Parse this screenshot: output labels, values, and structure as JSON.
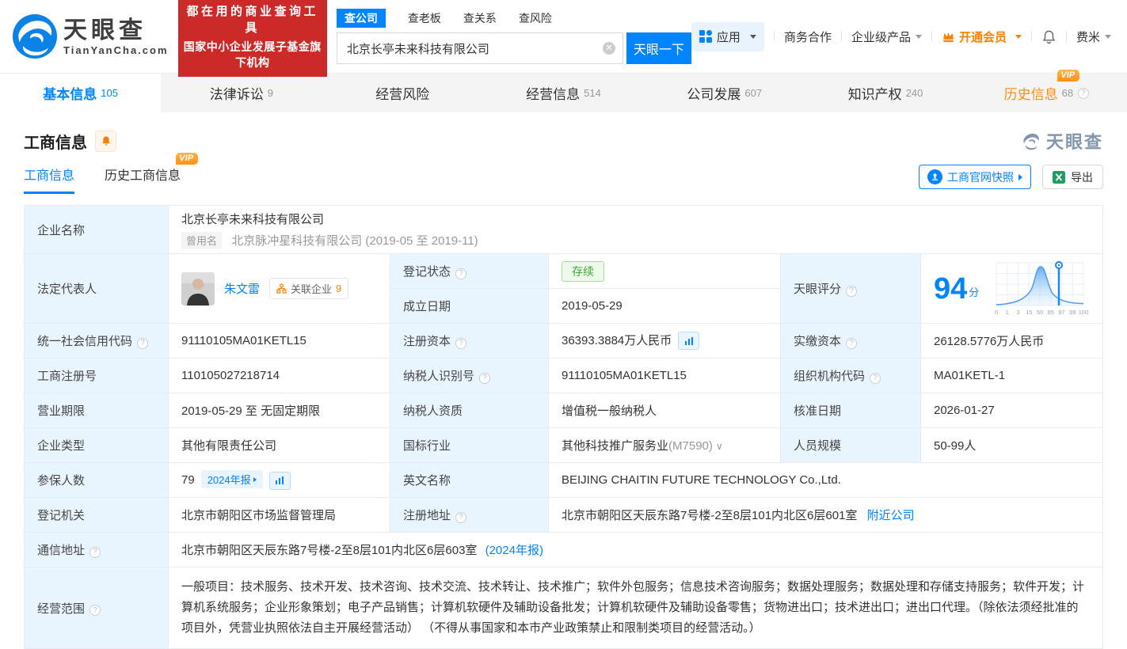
{
  "ui": {
    "vip": "VIP"
  },
  "header": {
    "logo": {
      "title": "天眼查",
      "domain": "TianYanCha.com"
    },
    "banner": {
      "line1": "都在用的商业查询工具",
      "line2": "国家中小企业发展子基金旗下机构"
    },
    "search": {
      "tabs": [
        {
          "label": "查公司"
        },
        {
          "label": "查老板"
        },
        {
          "label": "查关系"
        },
        {
          "label": "查风险"
        }
      ],
      "value": "北京长亭未来科技有限公司",
      "button": "天眼一下"
    },
    "nav": {
      "apps": "应用",
      "biz_coop": "商务合作",
      "enterprise": "企业级产品",
      "vip": "开通会员",
      "user": "费米"
    }
  },
  "tabbar": {
    "tabs": [
      {
        "label": "基本信息",
        "count": "105"
      },
      {
        "label": "法律诉讼",
        "count": "9"
      },
      {
        "label": "经营风险",
        "count": ""
      },
      {
        "label": "经营信息",
        "count": "514"
      },
      {
        "label": "公司发展",
        "count": "607"
      },
      {
        "label": "知识产权",
        "count": "240"
      },
      {
        "label": "历史信息",
        "count": "68"
      }
    ]
  },
  "section": {
    "title": "工商信息",
    "watermark": "天眼查",
    "subtabs": [
      {
        "label": "工商信息"
      },
      {
        "label": "历史工商信息"
      }
    ],
    "snapshot_button": "工商官网快照",
    "export_button": "导出"
  },
  "table": {
    "row1": {
      "label": "企业名称",
      "value": "北京长亭未来科技有限公司",
      "former_badge": "曾用名",
      "former": "北京脉冲星科技有限公司 (2019-05 至 2019-11)"
    },
    "row2": {
      "legal_label": "法定代表人",
      "legal_name": "朱文雷",
      "related_label": "关联企业",
      "related_count": "9",
      "status_label": "登记状态",
      "status": "存续",
      "date_label": "成立日期",
      "date": "2019-05-29",
      "score_label": "天眼评分",
      "score": "94",
      "score_unit": "分",
      "score_ticks": [
        "0",
        "1",
        "3",
        "15",
        "50",
        "85",
        "97",
        "99",
        "100"
      ]
    },
    "row3": {
      "l1": "统一社会信用代码",
      "v1": "91110105MA01KETL15",
      "l2": "注册资本",
      "v2": "36393.3884万人民币",
      "l3": "实缴资本",
      "v3": "26128.5776万人民币"
    },
    "row4": {
      "l1": "工商注册号",
      "v1": "110105027218714",
      "l2": "纳税人识别号",
      "v2": "91110105MA01KETL15",
      "l3": "组织机构代码",
      "v3": "MA01KETL-1"
    },
    "row5": {
      "l1": "营业期限",
      "v1": "2019-05-29 至 无固定期限",
      "l2": "纳税人资质",
      "v2": "增值税一般纳税人",
      "l3": "核准日期",
      "v3": "2026-01-27"
    },
    "row6": {
      "l1": "企业类型",
      "v1": "其他有限责任公司",
      "l2": "国标行业",
      "v2": "其他科技推广服务业",
      "v2_code": "(M7590)",
      "l3": "人员规模",
      "v3": "50-99人"
    },
    "row7": {
      "l1": "参保人数",
      "v1": "79",
      "report_badge": "2024年报",
      "l2": "英文名称",
      "v2": "BEIJING CHAITIN FUTURE TECHNOLOGY Co.,Ltd."
    },
    "row8": {
      "l1": "登记机关",
      "v1": "北京市朝阳区市场监督管理局",
      "l2": "注册地址",
      "v2": "北京市朝阳区天辰东路7号楼-2至8层101内北区6层601室",
      "v2_link": "附近公司"
    },
    "row9": {
      "label": "通信地址",
      "value": "北京市朝阳区天辰东路7号楼-2至8层101内北区6层603室",
      "link": "(2024年报)"
    },
    "row10": {
      "label": "经营范围",
      "value": "一般项目：技术服务、技术开发、技术咨询、技术交流、技术转让、技术推广；软件外包服务；信息技术咨询服务；数据处理服务；数据处理和存储支持服务；软件开发；计算机系统服务；企业形象策划；电子产品销售；计算机软硬件及辅助设备批发；计算机软硬件及辅助设备零售；货物进出口；技术进出口；进出口代理。（除依法须经批准的项目外，凭营业执照依法自主开展经营活动） （不得从事国家和本市产业政策禁止和限制类项目的经营活动。）"
    }
  },
  "colors": {
    "primary": "#0084ff",
    "orange": "#ff8000",
    "banner_red": "#cc2a29",
    "status_green": "#41a836"
  }
}
